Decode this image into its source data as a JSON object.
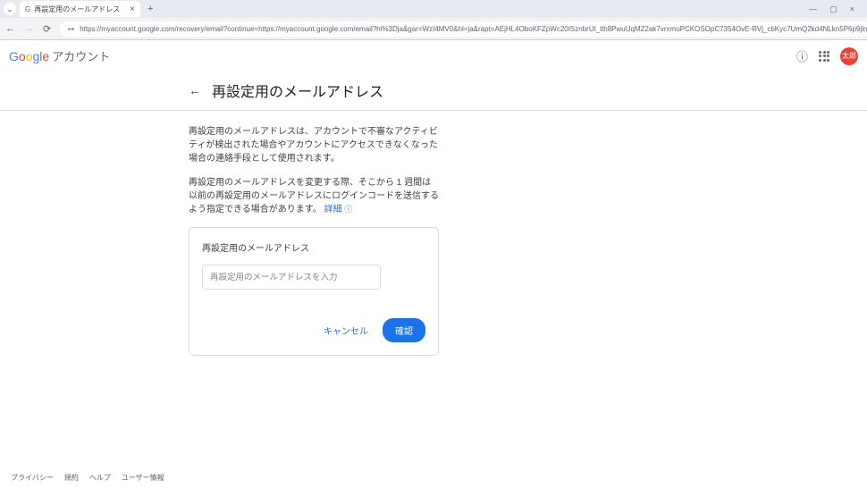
{
  "browser": {
    "tab_title": "再設定用のメールアドレス",
    "url": "https://myaccount.google.com/recovery/email?continue=https://myaccount.google.com/email?hl%3Dja&gar=WzI4MV0&hl=ja&rapt=AEjHL4OboKFZpWc20ISznbrUt_lth8PwuUqMZ2ak7vrxmuPCKOSOpC7354OvE-RVj_cbKyc7UmQ2kd4NLkn5P6p9jlnnqis5z..."
  },
  "header": {
    "account_label": "アカウント",
    "avatar_text": "太郎"
  },
  "page": {
    "title": "再設定用のメールアドレス",
    "intro1": "再設定用のメールアドレスは、アカウントで不審なアクティビティが検出された場合やアカウントにアクセスできなくなった場合の連絡手段として使用されます。",
    "intro2_prefix": "再設定用のメールアドレスを変更する際、そこから 1 週間は以前の再設定用のメールアドレスにログインコードを送信するよう指定できる場合があります。",
    "detail_link": "詳細"
  },
  "card": {
    "label": "再設定用のメールアドレス",
    "placeholder": "再設定用のメールアドレスを入力",
    "cancel": "キャンセル",
    "confirm": "確認"
  },
  "footer": {
    "privacy": "プライバシー",
    "terms": "規約",
    "help": "ヘルプ",
    "userinfo": "ユーザー情報"
  }
}
